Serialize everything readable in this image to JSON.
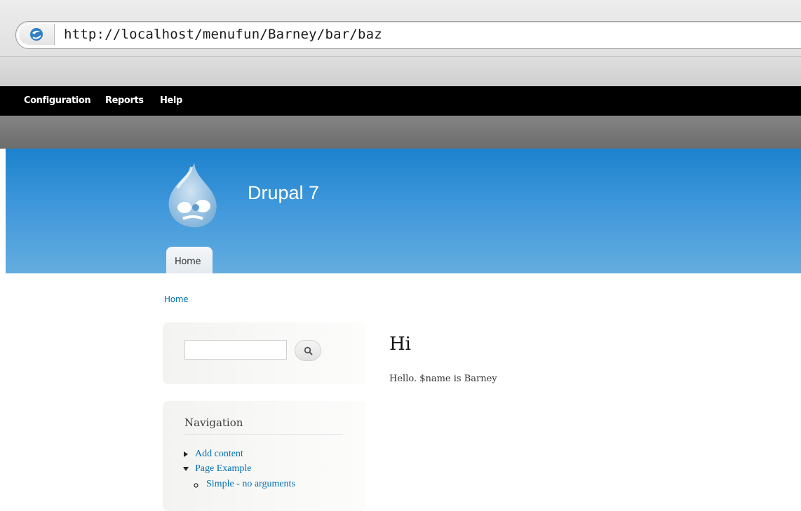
{
  "browser": {
    "url": "http://localhost/menufun/Barney/bar/baz"
  },
  "toolbar": {
    "items": [
      "Configuration",
      "Reports",
      "Help"
    ]
  },
  "header": {
    "site_name": "Drupal 7",
    "tabs": [
      "Home"
    ]
  },
  "breadcrumb": "Home",
  "sidebar": {
    "search": {
      "value": "",
      "button_icon": "search-icon"
    },
    "navigation": {
      "title": "Navigation",
      "items": [
        {
          "label": "Add content",
          "marker": "collapsed-arrow"
        },
        {
          "label": "Page Example",
          "marker": "expanded-arrow"
        },
        {
          "label": "Simple - no arguments",
          "marker": "circle-bullet"
        }
      ]
    }
  },
  "main": {
    "title": "Hi",
    "body": "Hello. $name is Barney"
  },
  "colors": {
    "toolbar": "#000000",
    "header_blue": "#3f97db",
    "link": "#0071b3"
  }
}
